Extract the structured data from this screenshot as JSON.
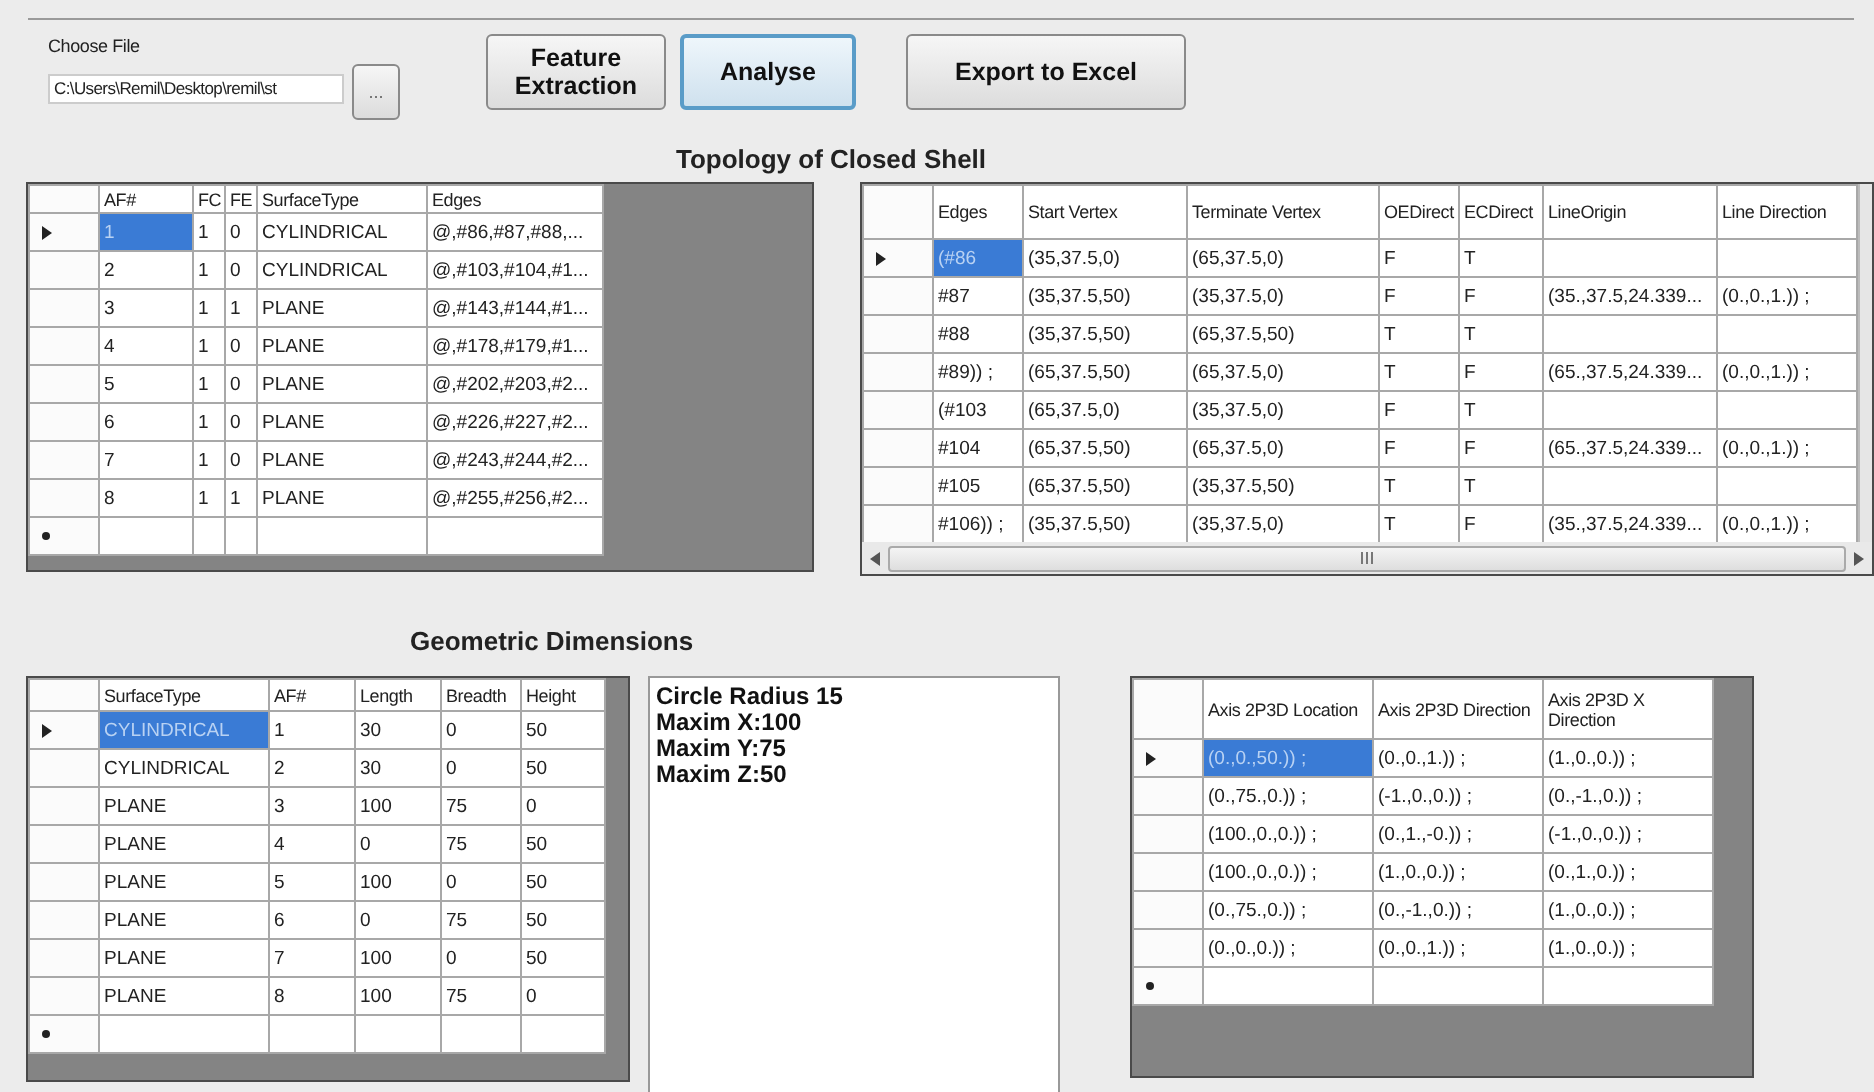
{
  "file_chooser": {
    "label": "Choose File",
    "value": "C:\\Users\\Remil\\Desktop\\remil\\st",
    "browse_button": "..."
  },
  "buttons": [
    {
      "label": "Feature Extraction",
      "focused": false
    },
    {
      "label": "Analyse",
      "focused": true
    },
    {
      "label": "Export to Excel",
      "focused": false
    }
  ],
  "sections": [
    {
      "title": "Topology of Closed Shell",
      "panels": [
        {
          "kind": "grid",
          "columns": [
            "AF#",
            "FC",
            "FE",
            "SurfaceType",
            "Edges"
          ],
          "rows": [
            {
              "selected": true,
              "cells": [
                "1",
                "1",
                "0",
                "CYLINDRICAL",
                "@,#86,#87,#88,..."
              ]
            },
            {
              "selected": false,
              "cells": [
                "2",
                "1",
                "0",
                "CYLINDRICAL",
                "@,#103,#104,#1..."
              ]
            },
            {
              "selected": false,
              "cells": [
                "3",
                "1",
                "1",
                "PLANE",
                "@,#143,#144,#1..."
              ]
            },
            {
              "selected": false,
              "cells": [
                "4",
                "1",
                "0",
                "PLANE",
                "@,#178,#179,#1..."
              ]
            },
            {
              "selected": false,
              "cells": [
                "5",
                "1",
                "0",
                "PLANE",
                "@,#202,#203,#2..."
              ]
            },
            {
              "selected": false,
              "cells": [
                "6",
                "1",
                "0",
                "PLANE",
                "@,#226,#227,#2..."
              ]
            },
            {
              "selected": false,
              "cells": [
                "7",
                "1",
                "0",
                "PLANE",
                "@,#243,#244,#2..."
              ]
            },
            {
              "selected": false,
              "cells": [
                "8",
                "1",
                "1",
                "PLANE",
                "@,#255,#256,#2..."
              ]
            }
          ]
        },
        {
          "kind": "grid",
          "columns": [
            "Edges",
            "Start Vertex",
            "Terminate Vertex",
            "OEDirect",
            "ECDirect",
            "LineOrigin",
            "Line Direction"
          ],
          "rows": [
            {
              "selected": true,
              "cells": [
                "(#86",
                "(35,37.5,0)",
                "(65,37.5,0)",
                "F",
                "T",
                "",
                ""
              ]
            },
            {
              "selected": false,
              "cells": [
                "#87",
                "(35,37.5,50)",
                "(35,37.5,0)",
                "F",
                "F",
                "(35.,37.5,24.339...",
                "(0.,0.,1.)) ;"
              ]
            },
            {
              "selected": false,
              "cells": [
                "#88",
                "(35,37.5,50)",
                "(65,37.5,50)",
                "T",
                "T",
                "",
                ""
              ]
            },
            {
              "selected": false,
              "cells": [
                "#89)) ;",
                "(65,37.5,50)",
                "(65,37.5,0)",
                "T",
                "F",
                "(65.,37.5,24.339...",
                "(0.,0.,1.)) ;"
              ]
            },
            {
              "selected": false,
              "cells": [
                "(#103",
                "(65,37.5,0)",
                "(35,37.5,0)",
                "F",
                "T",
                "",
                ""
              ]
            },
            {
              "selected": false,
              "cells": [
                "#104",
                "(65,37.5,50)",
                "(65,37.5,0)",
                "F",
                "F",
                "(65.,37.5,24.339...",
                "(0.,0.,1.)) ;"
              ]
            },
            {
              "selected": false,
              "cells": [
                "#105",
                "(65,37.5,50)",
                "(35,37.5,50)",
                "T",
                "T",
                "",
                ""
              ]
            },
            {
              "selected": false,
              "cells": [
                "#106)) ;",
                "(35,37.5,50)",
                "(35,37.5,0)",
                "T",
                "F",
                "(35.,37.5,24.339...",
                "(0.,0.,1.)) ;"
              ]
            }
          ]
        }
      ]
    },
    {
      "title": "Geometric Dimensions",
      "panels": [
        {
          "kind": "grid",
          "columns": [
            "SurfaceType",
            "AF#",
            "Length",
            "Breadth",
            "Height"
          ],
          "rows": [
            {
              "selected": true,
              "cells": [
                "CYLINDRICAL",
                "1",
                "30",
                "0",
                "50"
              ]
            },
            {
              "selected": false,
              "cells": [
                "CYLINDRICAL",
                "2",
                "30",
                "0",
                "50"
              ]
            },
            {
              "selected": false,
              "cells": [
                "PLANE",
                "3",
                "100",
                "75",
                "0"
              ]
            },
            {
              "selected": false,
              "cells": [
                "PLANE",
                "4",
                "0",
                "75",
                "50"
              ]
            },
            {
              "selected": false,
              "cells": [
                "PLANE",
                "5",
                "100",
                "0",
                "50"
              ]
            },
            {
              "selected": false,
              "cells": [
                "PLANE",
                "6",
                "0",
                "75",
                "50"
              ]
            },
            {
              "selected": false,
              "cells": [
                "PLANE",
                "7",
                "100",
                "0",
                "50"
              ]
            },
            {
              "selected": false,
              "cells": [
                "PLANE",
                "8",
                "100",
                "75",
                "0"
              ]
            }
          ]
        },
        {
          "kind": "text",
          "lines": [
            "Circle Radius 15",
            "Maxim X:100",
            "Maxim Y:75",
            "Maxim Z:50"
          ]
        },
        {
          "kind": "grid",
          "columns": [
            "Axis 2P3D Location",
            "Axis 2P3D Direction",
            "Axis 2P3D X Direction"
          ],
          "rows": [
            {
              "selected": true,
              "cells": [
                "(0.,0.,50.)) ;",
                "(0.,0.,1.)) ;",
                "(1.,0.,0.)) ;"
              ]
            },
            {
              "selected": false,
              "cells": [
                "(0.,75.,0.)) ;",
                "(-1.,0.,0.)) ;",
                "(0.,-1.,0.)) ;"
              ]
            },
            {
              "selected": false,
              "cells": [
                "(100.,0.,0.)) ;",
                "(0.,1.,-0.)) ;",
                "(-1.,0.,0.)) ;"
              ]
            },
            {
              "selected": false,
              "cells": [
                "(100.,0.,0.)) ;",
                "(1.,0.,0.)) ;",
                "(0.,1.,0.)) ;"
              ]
            },
            {
              "selected": false,
              "cells": [
                "(0.,75.,0.)) ;",
                "(0.,-1.,0.)) ;",
                "(1.,0.,0.)) ;"
              ]
            },
            {
              "selected": false,
              "cells": [
                "(0.,0.,0.)) ;",
                "(0.,0.,1.)) ;",
                "(1.,0.,0.)) ;"
              ]
            }
          ]
        }
      ]
    }
  ]
}
